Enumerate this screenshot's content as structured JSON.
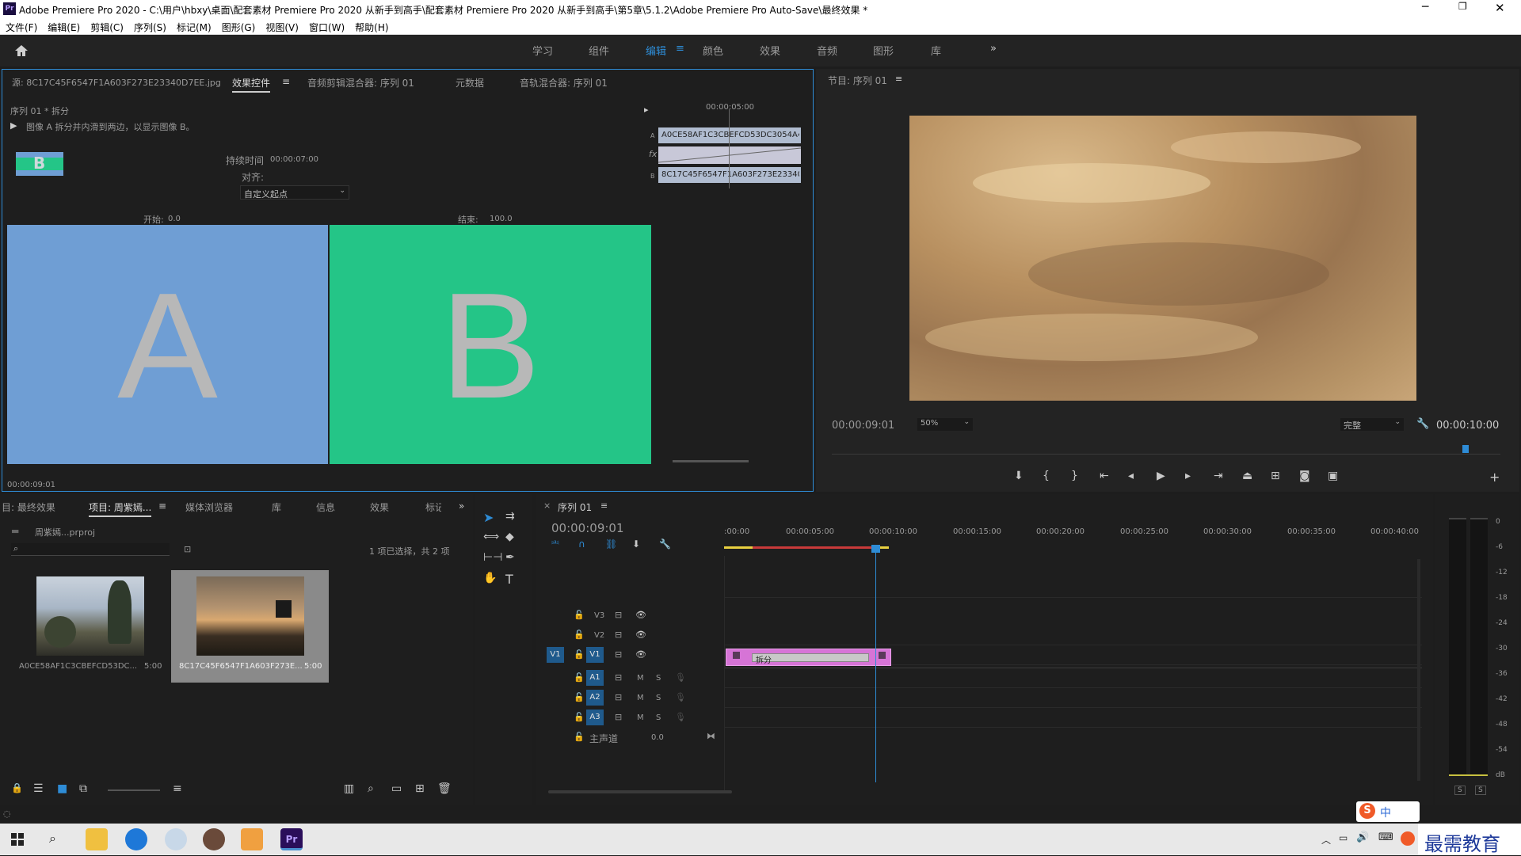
{
  "window": {
    "title": "Adobe Premiere Pro 2020 - C:\\用户\\hbxy\\桌面\\配套素材 Premiere Pro 2020 从新手到高手\\配套素材 Premiere Pro 2020 从新手到高手\\第5章\\5.1.2\\Adobe Premiere Pro Auto-Save\\最终效果 *",
    "app_icon": "Pr"
  },
  "menu": [
    "文件(F)",
    "编辑(E)",
    "剪辑(C)",
    "序列(S)",
    "标记(M)",
    "图形(G)",
    "视图(V)",
    "窗口(W)",
    "帮助(H)"
  ],
  "workspaces": [
    "学习",
    "组件",
    "编辑",
    "颜色",
    "效果",
    "音频",
    "图形",
    "库"
  ],
  "active_workspace": "编辑",
  "effect_controls": {
    "tabs": [
      "源: 8C17C45F6547F1A603F273E23340D7EE.jpg",
      "效果控件",
      "音频剪辑混合器: 序列 01",
      "元数据",
      "音轨混合器: 序列 01"
    ],
    "breadcrumb": "序列 01 * 拆分",
    "description": "图像 A 拆分并内滑到两边，以显示图像 B。",
    "duration_label": "持续时间",
    "duration_value": "00:00:07:00",
    "align_label": "对齐:",
    "align_value": "自定义起点",
    "start_label": "开始:",
    "start_value": "0.0",
    "end_label": "结束:",
    "end_value": "100.0",
    "preview_a": "A",
    "preview_b": "B",
    "thumb_b": "B",
    "mini_timecode": "00:00:05:00",
    "clip_a": "A0CE58AF1C3CBEFCD53DC3054A4",
    "clip_b": "8C17C45F6547F1A603F273E23340D",
    "row_a": "A",
    "row_fx": "fx",
    "row_b": "B",
    "current_time": "00:00:09:01"
  },
  "program": {
    "title": "节目: 序列 01",
    "timecode": "00:00:09:01",
    "zoom": "50%",
    "quality": "完整",
    "duration": "00:00:10:00"
  },
  "project": {
    "tabs": [
      "目: 最终效果",
      "项目: 周紫嫣...",
      "媒体浏览器",
      "库",
      "信息",
      "效果",
      "标记"
    ],
    "file": "周紫嫣...prproj",
    "selection": "1 项已选择，共 2 项",
    "items": [
      {
        "name": "A0CE58AF1C3CBEFCD53DC...",
        "duration": "5:00"
      },
      {
        "name": "8C17C45F6547F1A603F273E...",
        "duration": "5:00"
      }
    ]
  },
  "timeline": {
    "tab": "序列 01",
    "timecode": "00:00:09:01",
    "ruler": [
      ":00:00",
      "00:00:05:00",
      "00:00:10:00",
      "00:00:15:00",
      "00:00:20:00",
      "00:00:25:00",
      "00:00:30:00",
      "00:00:35:00",
      "00:00:40:00"
    ],
    "video_tracks": [
      "V3",
      "V2",
      "V1"
    ],
    "audio_tracks": [
      "A1",
      "A2",
      "A3"
    ],
    "source_patch_v": "V1",
    "master_label": "主声道",
    "master_value": "0.0",
    "clip_label": "拆分",
    "m_label": "M",
    "s_label": "S"
  },
  "meter": {
    "scale": [
      "0",
      "-6",
      "-12",
      "-18",
      "-24",
      "-30",
      "-36",
      "-42",
      "-48",
      "-54",
      "dB"
    ],
    "solo": [
      "S",
      "S"
    ]
  },
  "watermark": "最需教育",
  "ime": "中",
  "colors": {
    "accent": "#2e8cd6",
    "clip_pink": "#d674d6",
    "preview_a": "#6f9ed4",
    "preview_b": "#24c587"
  }
}
